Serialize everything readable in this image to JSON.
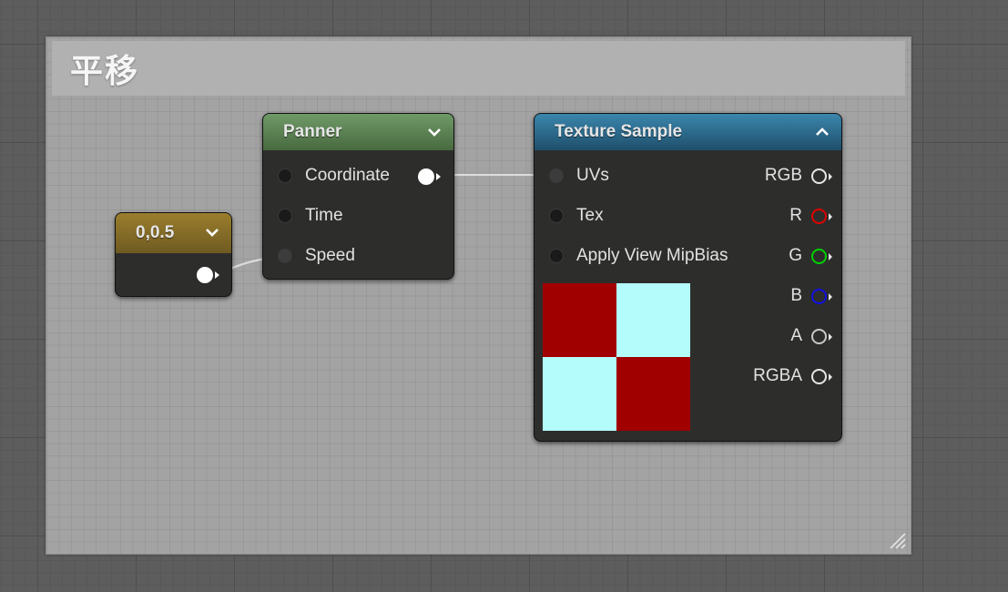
{
  "comment": {
    "title": "平移"
  },
  "nodes": {
    "constant": {
      "title": "0,0.5",
      "header_color": "#8a6f28"
    },
    "panner": {
      "title": "Panner",
      "header_color": "#5d8a58",
      "inputs": [
        "Coordinate",
        "Time",
        "Speed"
      ]
    },
    "texture_sample": {
      "title": "Texture Sample",
      "header_color": "#2d6f93",
      "inputs": [
        "UVs",
        "Tex",
        "Apply View MipBias"
      ],
      "outputs": [
        {
          "label": "RGB",
          "color": "#e6e6e6"
        },
        {
          "label": "R",
          "color": "#e00000"
        },
        {
          "label": "G",
          "color": "#00d000"
        },
        {
          "label": "B",
          "color": "#1010e0"
        },
        {
          "label": "A",
          "color": "#c8c8c8"
        },
        {
          "label": "RGBA",
          "color": "#e6e6e6"
        }
      ],
      "preview_colors": {
        "red": "#a10000",
        "cyan": "#b4fcfc"
      }
    }
  }
}
